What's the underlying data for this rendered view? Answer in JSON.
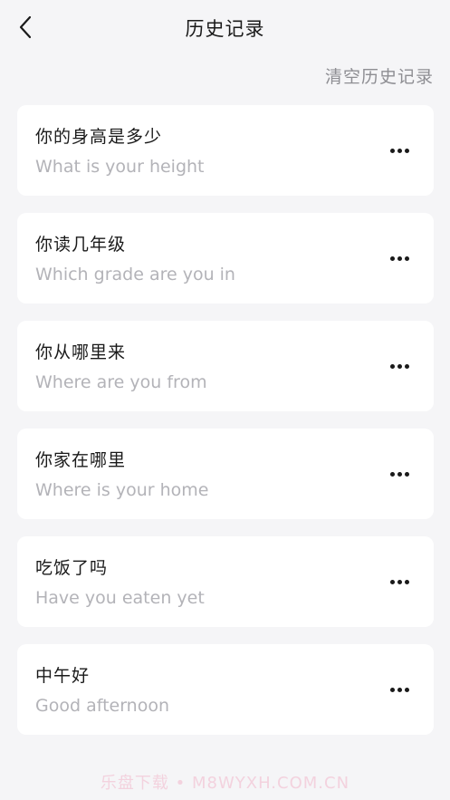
{
  "header": {
    "title": "历史记录",
    "back_icon": "chevron-left-icon"
  },
  "actions": {
    "clear_history": "清空历史记录"
  },
  "items": [
    {
      "zh": "你的身高是多少",
      "en": "What is your height"
    },
    {
      "zh": "你读几年级",
      "en": "Which grade are you in"
    },
    {
      "zh": "你从哪里来",
      "en": "Where are you from"
    },
    {
      "zh": "你家在哪里",
      "en": "Where is your home"
    },
    {
      "zh": "吃饭了吗",
      "en": "Have you eaten yet"
    },
    {
      "zh": "中午好",
      "en": "Good afternoon"
    }
  ],
  "watermark": "乐盘下载 • M8WYXH.COM.CN",
  "colors": {
    "background": "#f5f5f7",
    "card": "#ffffff",
    "primary_text": "#1a1a1a",
    "secondary_text": "#b3b3b8",
    "action_text": "#8e8e93"
  }
}
